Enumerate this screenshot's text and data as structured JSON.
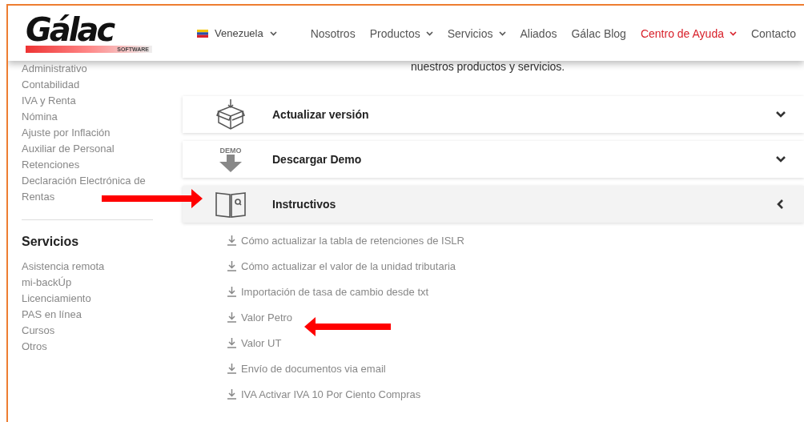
{
  "header": {
    "logo": {
      "name": "Gálac",
      "tagline": "SOFTWARE"
    },
    "country": "Venezuela",
    "nav": [
      {
        "label": "Nosotros",
        "dropdown": false,
        "selected": false
      },
      {
        "label": "Productos",
        "dropdown": true,
        "selected": false
      },
      {
        "label": "Servicios",
        "dropdown": true,
        "selected": false
      },
      {
        "label": "Aliados",
        "dropdown": false,
        "selected": false
      },
      {
        "label": "Gálac Blog",
        "dropdown": false,
        "selected": false
      },
      {
        "label": "Centro de Ayuda",
        "dropdown": true,
        "selected": true
      },
      {
        "label": "Contacto",
        "dropdown": false,
        "selected": false
      }
    ]
  },
  "intro_text": "nuestros productos y servicios.",
  "sidebar": {
    "product_links": [
      "Administrativo",
      "Contabilidad",
      "IVA y Renta",
      "Nómina",
      "Ajuste por Inflación",
      "Auxiliar de Personal",
      "Retenciones",
      "Declaración Electrónica de Rentas"
    ],
    "services_heading": "Servicios",
    "service_links": [
      "Asistencia remota",
      "mi-backÚp",
      "Licenciamiento",
      "PAS en línea",
      "Cursos",
      "Otros"
    ]
  },
  "accordion": [
    {
      "kind": "box",
      "title": "Actualizar versión",
      "expanded": false
    },
    {
      "kind": "demo",
      "icon_text": "DEMO",
      "title": "Descargar Demo",
      "expanded": false
    },
    {
      "kind": "book",
      "title": "Instructivos",
      "expanded": true,
      "links": [
        "Cómo actualizar la tabla de retenciones de ISLR",
        "Cómo actualizar el valor de la unidad tributaria",
        "Importación de tasa de cambio desde txt",
        "Valor Petro",
        "Valor UT",
        "Envío de documentos via email",
        "IVA Activar IVA 10 Por Ciento Compras"
      ]
    }
  ]
}
